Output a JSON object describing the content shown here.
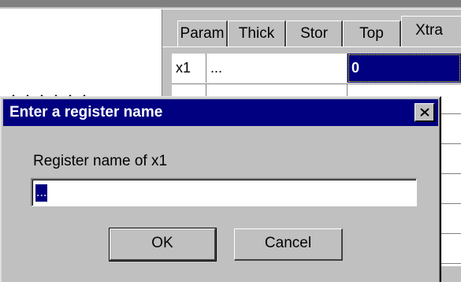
{
  "tabs": [
    {
      "label": "Param",
      "active": false
    },
    {
      "label": "Thick",
      "active": false
    },
    {
      "label": "Stor",
      "active": false
    },
    {
      "label": "Top",
      "active": false
    },
    {
      "label": "Xtra",
      "active": true
    }
  ],
  "grid": {
    "rows": [
      {
        "name": "x1",
        "label": "...",
        "value": "0",
        "selected": true
      },
      {
        "name": "",
        "label": "",
        "value": "",
        "selected": false
      },
      {
        "name": "",
        "label": "",
        "value": "",
        "selected": false
      },
      {
        "name": "",
        "label": "",
        "value": "",
        "selected": false
      },
      {
        "name": "",
        "label": "",
        "value": "",
        "selected": false
      },
      {
        "name": "",
        "label": "",
        "value": "",
        "selected": false
      },
      {
        "name": "",
        "label": "",
        "value": "",
        "selected": false
      }
    ]
  },
  "dialog": {
    "title": "Enter a register name",
    "prompt": "Register name of x1",
    "input_value": "...",
    "ok_label": "OK",
    "cancel_label": "Cancel"
  },
  "colors": {
    "face": "#c0c0c0",
    "titlebar": "#000080",
    "selection": "#000080"
  }
}
